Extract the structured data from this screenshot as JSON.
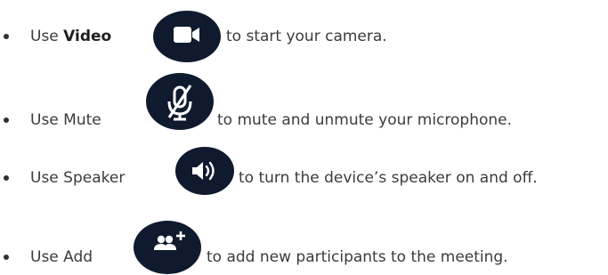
{
  "items": [
    {
      "prefix": "Use ",
      "bold": "Video",
      "suffix": "to start your camera.",
      "icon": "video-camera-icon"
    },
    {
      "prefix": "Use Mute",
      "suffix": "to mute and unmute your microphone.",
      "icon": "microphone-muted-icon"
    },
    {
      "prefix": "Use Speaker",
      "suffix": "to turn the device’s speaker on and off.",
      "icon": "speaker-icon"
    },
    {
      "prefix": "Use Add",
      "suffix": "to add new participants to the meeting.",
      "icon": "add-participants-icon"
    }
  ],
  "colors": {
    "button_bg": "#0f1a2e",
    "icon_fg": "#ffffff",
    "text": "#3b3b3b"
  }
}
